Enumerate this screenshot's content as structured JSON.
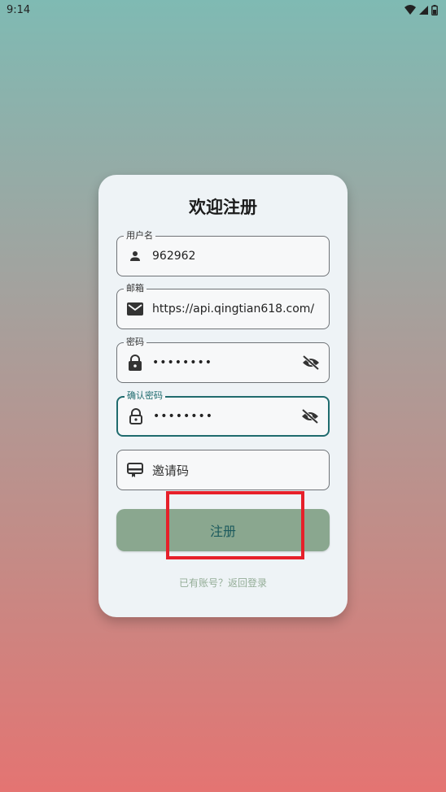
{
  "status_bar": {
    "time": "9:14"
  },
  "form": {
    "title": "欢迎注册",
    "username": {
      "label": "用户名",
      "value": "962962",
      "icon": "person-icon"
    },
    "email": {
      "label": "邮箱",
      "value": "https://api.qingtian618.com/",
      "icon": "mail-icon"
    },
    "password": {
      "label": "密码",
      "value": "••••••••",
      "icon": "lock-icon"
    },
    "confirm_password": {
      "label": "确认密码",
      "value": "••••••••",
      "icon": "lock-outline-icon"
    },
    "invite_code": {
      "placeholder": "邀请码",
      "icon": "card-icon"
    },
    "register_button": "注册",
    "login_link": "已有账号？返回登录"
  },
  "colors": {
    "accent": "#1f6b6e",
    "button": "#8aa78f",
    "highlight": "#e6202a"
  }
}
